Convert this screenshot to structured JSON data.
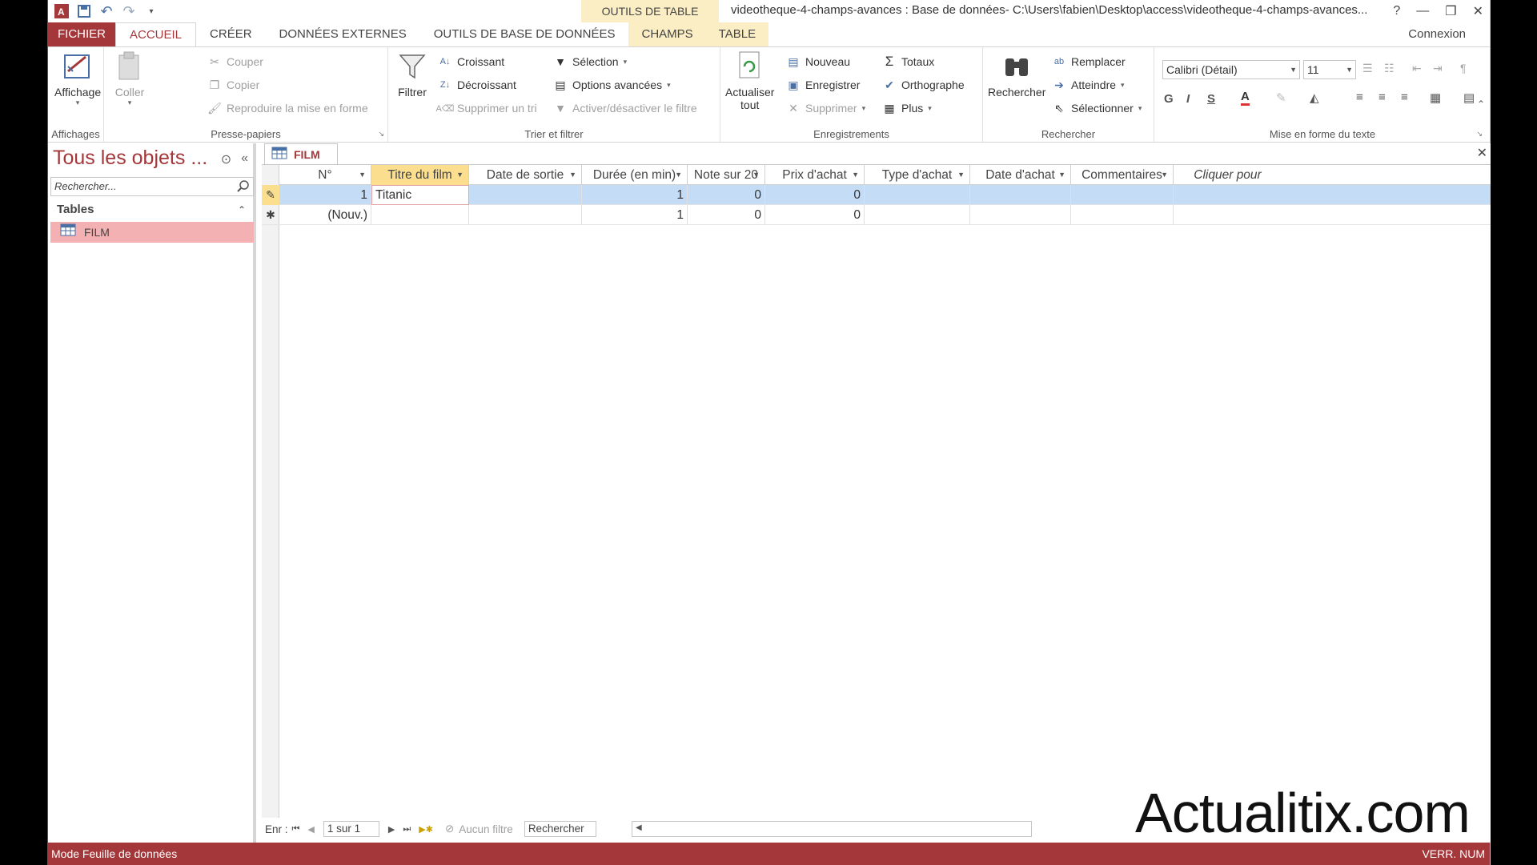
{
  "titlebar": {
    "context_tab_group": "OUTILS DE TABLE",
    "window_title": "videotheque-4-champs-avances : Base de données- C:\\Users\\fabien\\Desktop\\access\\videotheque-4-champs-avances...",
    "help": "?",
    "minimize": "—",
    "restore": "❐",
    "close": "✕"
  },
  "tabs": {
    "file": "FICHIER",
    "home": "ACCUEIL",
    "create": "CRÉER",
    "external": "DONNÉES EXTERNES",
    "dbtools": "OUTILS DE BASE DE DONNÉES",
    "fields": "CHAMPS",
    "table": "TABLE",
    "signin": "Connexion"
  },
  "ribbon": {
    "views": {
      "label": "Affichage",
      "group": "Affichages"
    },
    "clipboard": {
      "paste": "Coller",
      "cut": "Couper",
      "copy": "Copier",
      "format_painter": "Reproduire la mise en forme",
      "group": "Presse-papiers"
    },
    "sort_filter": {
      "filter": "Filtrer",
      "ascending": "Croissant",
      "descending": "Décroissant",
      "remove_sort": "Supprimer un tri",
      "selection": "Sélection",
      "advanced": "Options avancées",
      "toggle_filter": "Activer/désactiver le filtre",
      "group": "Trier et filtrer"
    },
    "records": {
      "refresh": "Actualiser",
      "refresh2": "tout",
      "new": "Nouveau",
      "save": "Enregistrer",
      "delete": "Supprimer",
      "totals": "Totaux",
      "spelling": "Orthographe",
      "more": "Plus",
      "group": "Enregistrements"
    },
    "find": {
      "find": "Rechercher",
      "replace": "Remplacer",
      "goto": "Atteindre",
      "select": "Sélectionner",
      "group": "Rechercher"
    },
    "text_format": {
      "font": "Calibri (Détail)",
      "size": "11",
      "bold": "G",
      "italic": "I",
      "underline": "S",
      "group": "Mise en forme du texte"
    }
  },
  "navpane": {
    "title": "Tous les objets ...",
    "search_placeholder": "Rechercher...",
    "section": "Tables",
    "items": [
      {
        "label": "FILM"
      }
    ]
  },
  "document": {
    "tab_label": "FILM",
    "columns": [
      {
        "label": "N°"
      },
      {
        "label": "Titre du film"
      },
      {
        "label": "Date de sortie"
      },
      {
        "label": "Durée (en min)"
      },
      {
        "label": "Note sur 20"
      },
      {
        "label": "Prix d'achat"
      },
      {
        "label": "Type d'achat"
      },
      {
        "label": "Date d'achat"
      },
      {
        "label": "Commentaires"
      },
      {
        "label": "Cliquer pour ajouter"
      }
    ],
    "rows": [
      {
        "id": "1",
        "title": "Titanic",
        "release": "",
        "duration": "1",
        "rating": "0",
        "price": "0",
        "type": "",
        "date": "",
        "comments": ""
      },
      {
        "id": "(Nouv.)",
        "title": "",
        "release": "",
        "duration": "1",
        "rating": "0",
        "price": "0",
        "type": "",
        "date": "",
        "comments": ""
      }
    ],
    "recnav": {
      "label": "Enr :",
      "position": "1 sur 1",
      "filter": "Aucun filtre",
      "search": "Rechercher"
    }
  },
  "watermark": "Actualitix.com",
  "statusbar": {
    "mode": "Mode Feuille de données",
    "indicators": "VERR. NUM"
  },
  "colors": {
    "accent": "#a4373a",
    "selected_header": "#fbdf8e",
    "current_row": "#c5dcf6",
    "nav_selected": "#f3b1b3"
  }
}
